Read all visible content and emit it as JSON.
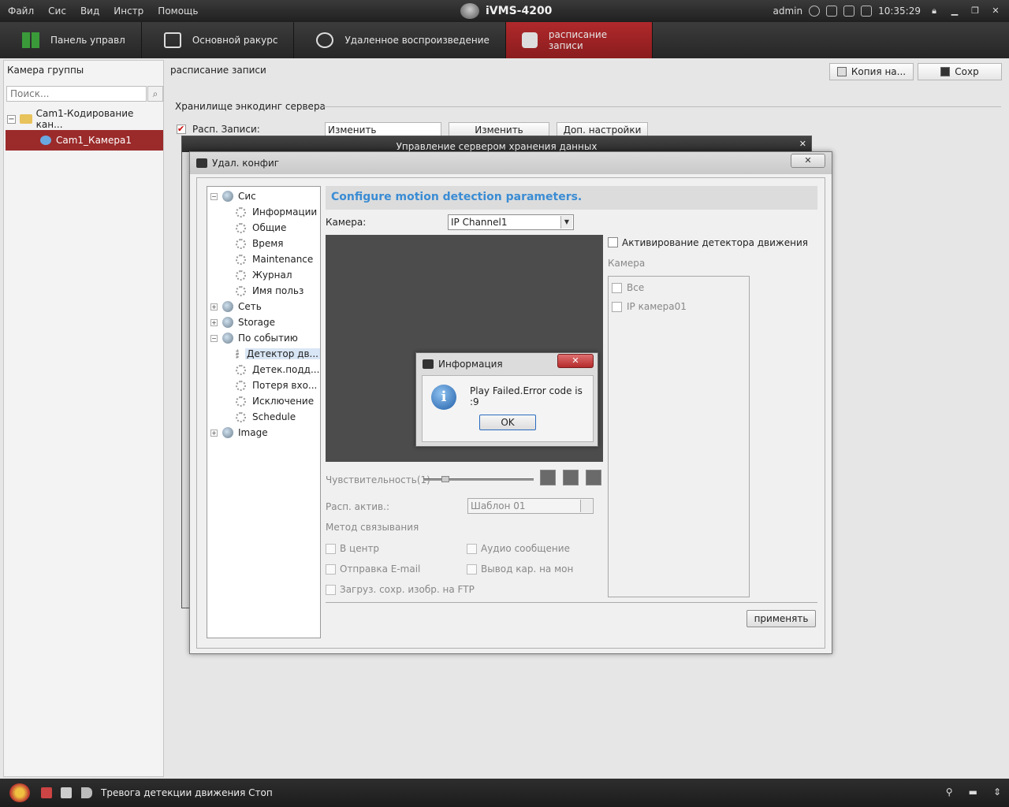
{
  "menu": [
    "Файл",
    "Сис",
    "Вид",
    "Инстр",
    "Помощь"
  ],
  "app_title": "iVMS-4200",
  "tray": {
    "user": "admin",
    "time": "10:35:29"
  },
  "tabs": [
    {
      "label": "Панель управл",
      "active": false
    },
    {
      "label": "Основной ракурс",
      "active": false
    },
    {
      "label": "Удаленное воспроизведение",
      "active": false
    },
    {
      "label": "расписание записи",
      "active": true
    }
  ],
  "left_panel": {
    "title": "Камера группы",
    "search_placeholder": "Поиск...",
    "group": "Cam1-Кодирование кан...",
    "camera": "Cam1_Камера1"
  },
  "main": {
    "title": "расписание записи",
    "copy_label": "Копия на...",
    "save_label": "Сохр",
    "storage_label": "Хранилище энкодинг сервера",
    "rec_label": "Расп. Записи:",
    "rec_select": "Изменить",
    "edit_label": "Изменить",
    "adv_label": "Доп. настройки"
  },
  "bg_dialog": {
    "title": "Управление сервером хранения данных"
  },
  "cfg_dialog": {
    "title": "Удал. конфиг",
    "tree": [
      {
        "label": "Сис",
        "level": 0,
        "expander": "−"
      },
      {
        "label": "Информации",
        "level": 1
      },
      {
        "label": "Общие",
        "level": 1
      },
      {
        "label": "Время",
        "level": 1
      },
      {
        "label": "Maintenance",
        "level": 1
      },
      {
        "label": "Журнал",
        "level": 1
      },
      {
        "label": "Имя польз",
        "level": 1
      },
      {
        "label": "Сеть",
        "level": 0,
        "expander": "+"
      },
      {
        "label": "Storage",
        "level": 0,
        "expander": "+"
      },
      {
        "label": "По событию",
        "level": 0,
        "expander": "−"
      },
      {
        "label": "Детектор дв...",
        "level": 1,
        "selected": true
      },
      {
        "label": "Детек.подд...",
        "level": 1
      },
      {
        "label": "Потеря вхо...",
        "level": 1
      },
      {
        "label": "Исключение",
        "level": 1
      },
      {
        "label": "Schedule",
        "level": 1
      },
      {
        "label": "Image",
        "level": 0,
        "expander": "+"
      }
    ],
    "header": "Configure motion detection parameters.",
    "camera_label": "Камера:",
    "camera_value": "IP Channel1",
    "motion_label": "Активирование детектора движения",
    "camera_sub_label": "Камера",
    "camera_list": [
      "Все",
      "IP камера01"
    ],
    "sensitivity_label": "Чувствительность(1)",
    "sensitivity_level": 0.2,
    "schedule_label": "Расп. актив.:",
    "schedule_value": "Шаблон 01",
    "link_label": "Метод связывания",
    "options": {
      "center": "В центр",
      "audio": "Аудио сообщение",
      "email": "Отправка E-mail",
      "monitor": "Вывод кар. на мон",
      "ftp": "Загруз. сохр. изобр. на FTP"
    },
    "apply_label": "применять"
  },
  "info_dialog": {
    "title": "Информация",
    "message": "Play Failed.Error code is :9",
    "ok_label": "OK"
  },
  "status": {
    "text": "Тревога детекции движения Стоп"
  }
}
